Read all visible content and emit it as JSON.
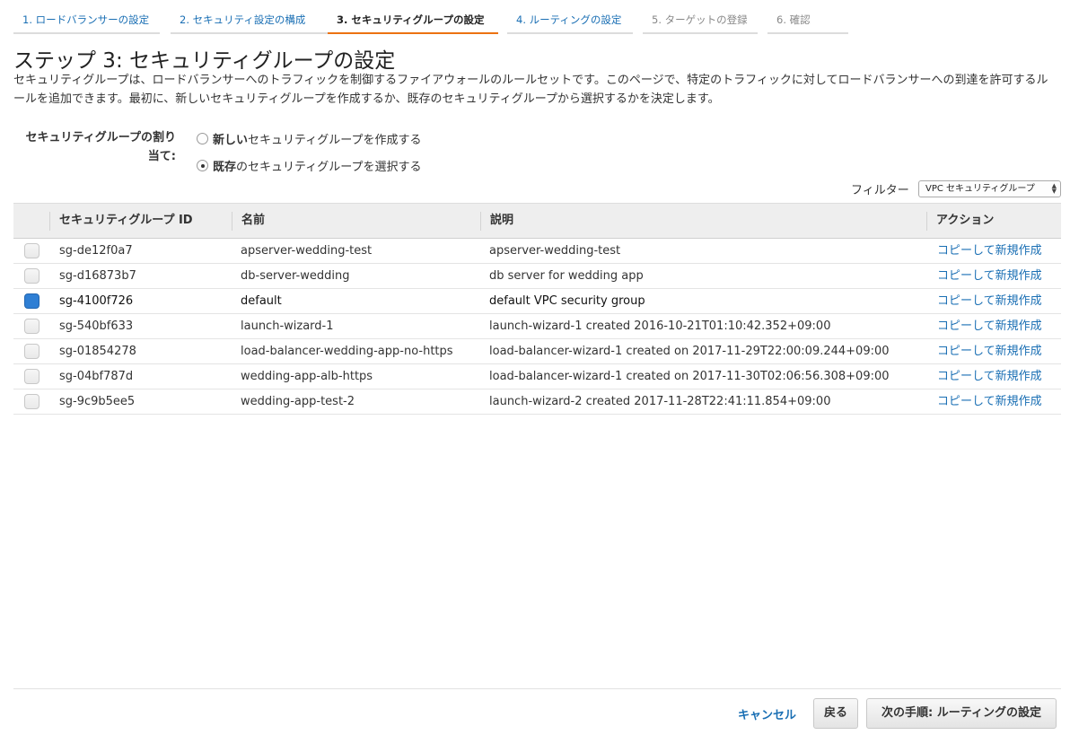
{
  "wizard": {
    "steps": [
      {
        "label": "1. ロードバランサーの設定"
      },
      {
        "label": "2. セキュリティ設定の構成"
      },
      {
        "label": "3. セキュリティグループの設定"
      },
      {
        "label": "4. ルーティングの設定"
      },
      {
        "label": "5. ターゲットの登録"
      },
      {
        "label": "6. 確認"
      }
    ]
  },
  "page": {
    "title": "ステップ 3: セキュリティグループの設定",
    "description": "セキュリティグループは、ロードバランサーへのトラフィックを制御するファイアウォールのルールセットです。このページで、特定のトラフィックに対してロードバランサーへの到達を許可するルールを追加できます。最初に、新しいセキュリティグループを作成するか、既存のセキュリティグループから選択するかを決定します。"
  },
  "assignment": {
    "label": "セキュリティグループの割り当て:",
    "options": [
      {
        "bold": "新しい",
        "rest": "セキュリティグループを作成する",
        "selected": false
      },
      {
        "bold": "既存",
        "rest": "のセキュリティグループを選択する",
        "selected": true
      }
    ]
  },
  "filter": {
    "label": "フィルター",
    "value": "VPC セキュリティグループ"
  },
  "table": {
    "headers": {
      "id": "セキュリティグループ ID",
      "name": "名前",
      "description": "説明",
      "action": "アクション"
    },
    "rows": [
      {
        "id": "sg-de12f0a7",
        "name": "apserver-wedding-test",
        "description": "apserver-wedding-test",
        "action": "コピーして新規作成",
        "checked": false
      },
      {
        "id": "sg-d16873b7",
        "name": "db-server-wedding",
        "description": "db server for wedding app",
        "action": "コピーして新規作成",
        "checked": false
      },
      {
        "id": "sg-4100f726",
        "name": "default",
        "description": "default VPC security group",
        "action": "コピーして新規作成",
        "checked": true
      },
      {
        "id": "sg-540bf633",
        "name": "launch-wizard-1",
        "description": "launch-wizard-1 created 2016-10-21T01:10:42.352+09:00",
        "action": "コピーして新規作成",
        "checked": false
      },
      {
        "id": "sg-01854278",
        "name": "load-balancer-wedding-app-no-https",
        "description": "load-balancer-wizard-1 created on 2017-11-29T22:00:09.244+09:00",
        "action": "コピーして新規作成",
        "checked": false
      },
      {
        "id": "sg-04bf787d",
        "name": "wedding-app-alb-https",
        "description": "load-balancer-wizard-1 created on 2017-11-30T02:06:56.308+09:00",
        "action": "コピーして新規作成",
        "checked": false
      },
      {
        "id": "sg-9c9b5ee5",
        "name": "wedding-app-test-2",
        "description": "launch-wizard-2 created 2017-11-28T22:41:11.854+09:00",
        "action": "コピーして新規作成",
        "checked": false
      }
    ]
  },
  "footer": {
    "cancel_label": "キャンセル",
    "back_label": "戻る",
    "next_label": "次の手順: ルーティングの設定"
  }
}
